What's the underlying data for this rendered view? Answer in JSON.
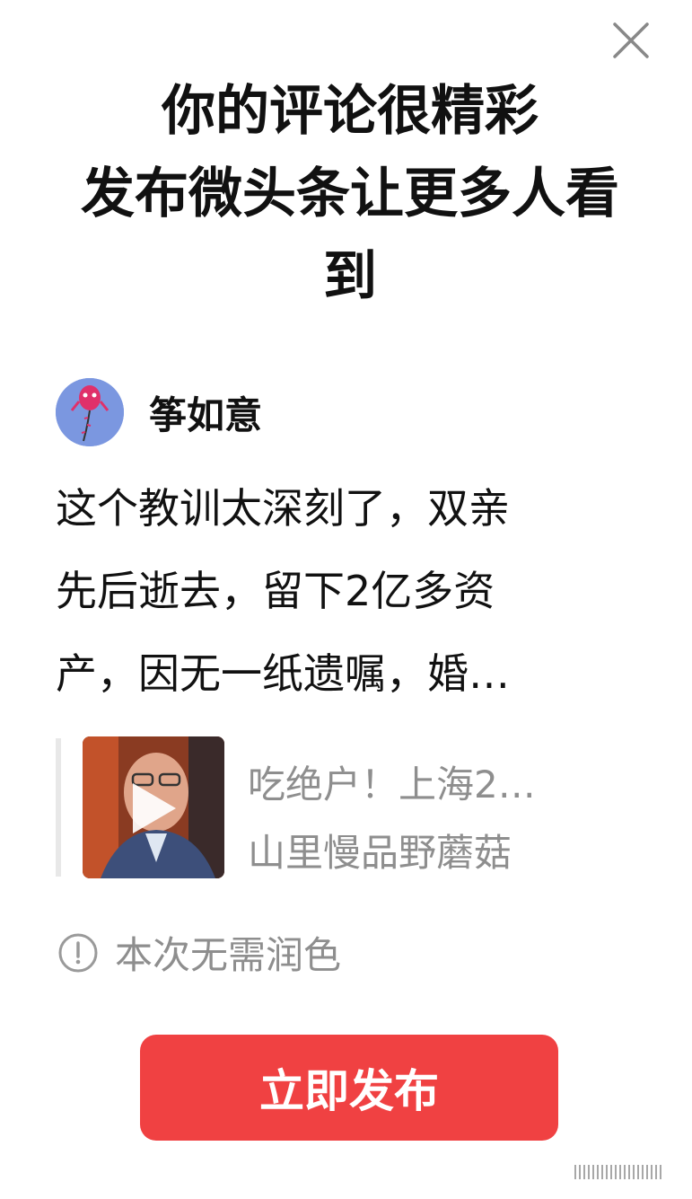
{
  "dialog": {
    "close_icon": "close-icon",
    "headline_lines": [
      "你的评论很精彩",
      "发布微头条让更多人看",
      "到"
    ]
  },
  "author": {
    "name": "筝如意",
    "avatar_icon": "kite-avatar-icon"
  },
  "comment": {
    "lines": [
      "这个教训太深刻了，双亲",
      "先后逝去，留下2亿多资",
      "产，因无一纸遗嘱，婚…"
    ]
  },
  "quoted_video": {
    "title": "吃绝户！上海2…",
    "author": "山里慢品野蘑菇",
    "play_icon": "play-icon"
  },
  "notice": {
    "icon": "info-icon",
    "text": "本次无需润色"
  },
  "publish_button": {
    "label": "立即发布",
    "color": "#f04142"
  },
  "colors": {
    "primary_text": "#111111",
    "secondary_text": "#8e8e8e",
    "accent": "#f04142"
  }
}
